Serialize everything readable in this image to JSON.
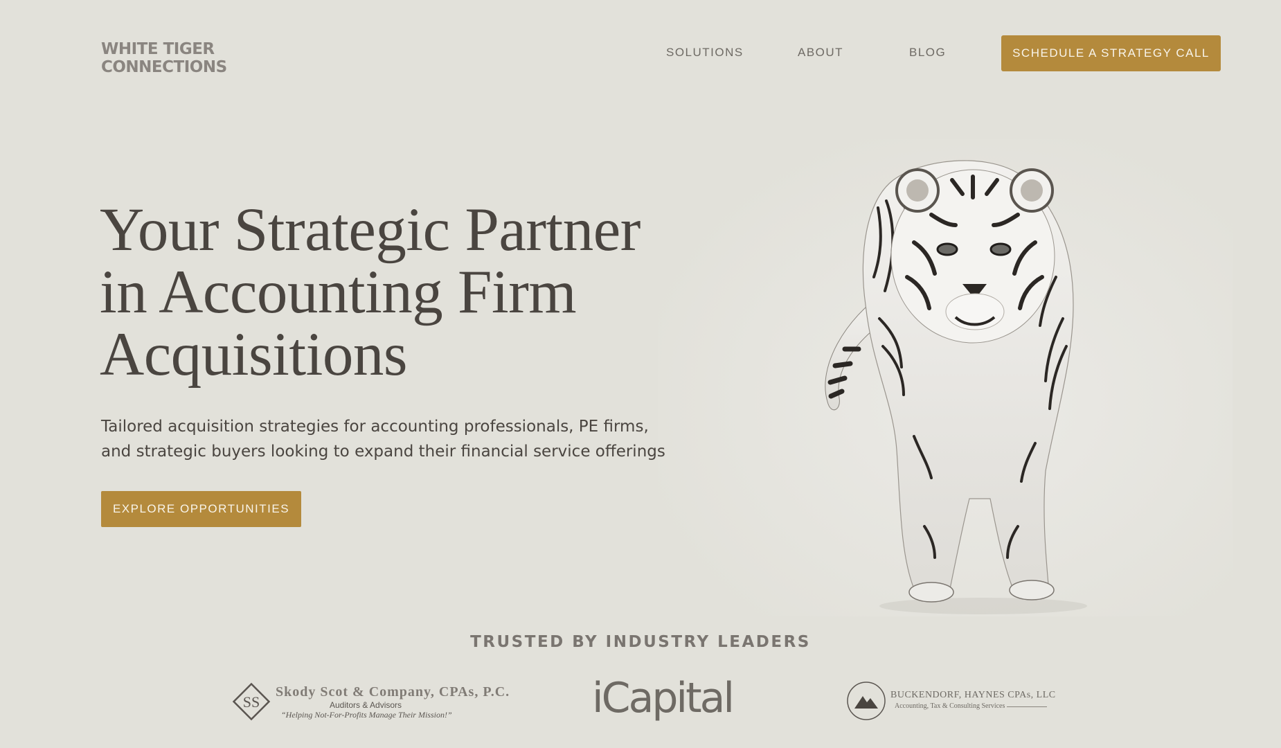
{
  "header": {
    "logo_line1": "WHITE TIGER",
    "logo_line2": "CONNECTIONS",
    "nav": [
      {
        "label": "SOLUTIONS"
      },
      {
        "label": "ABOUT"
      },
      {
        "label": "BLOG"
      }
    ],
    "cta_label": "SCHEDULE A STRATEGY CALL"
  },
  "hero": {
    "title_line1": "Your Strategic Partner",
    "title_line2": "in Accounting Firm",
    "title_line3": "Acquisitions",
    "subtitle_line1": "Tailored acquisition strategies for accounting professionals, PE firms,",
    "subtitle_line2": "and strategic buyers looking to expand their financial service offerings",
    "button_label": "EXPLORE OPPORTUNITIES",
    "image_icon": "white-tiger-photo"
  },
  "trusted": {
    "heading": "TRUSTED BY INDUSTRY LEADERS",
    "logos": [
      {
        "monogram": "SS",
        "name": "Skody Scot & Company, CPAs, P.C.",
        "tagline": "Auditors & Advisors",
        "motto": "“Helping Not-For-Profits Manage Their Mission!”"
      },
      {
        "name": "iCapital"
      },
      {
        "name": "BUCKENDORF, HAYNES CPAs, LLC",
        "tagline": "Accounting, Tax & Consulting Services",
        "icon": "mountain-icon"
      }
    ]
  },
  "colors": {
    "background": "#e2e1da",
    "accent": "#b48a3c",
    "text": "#4a4540"
  }
}
